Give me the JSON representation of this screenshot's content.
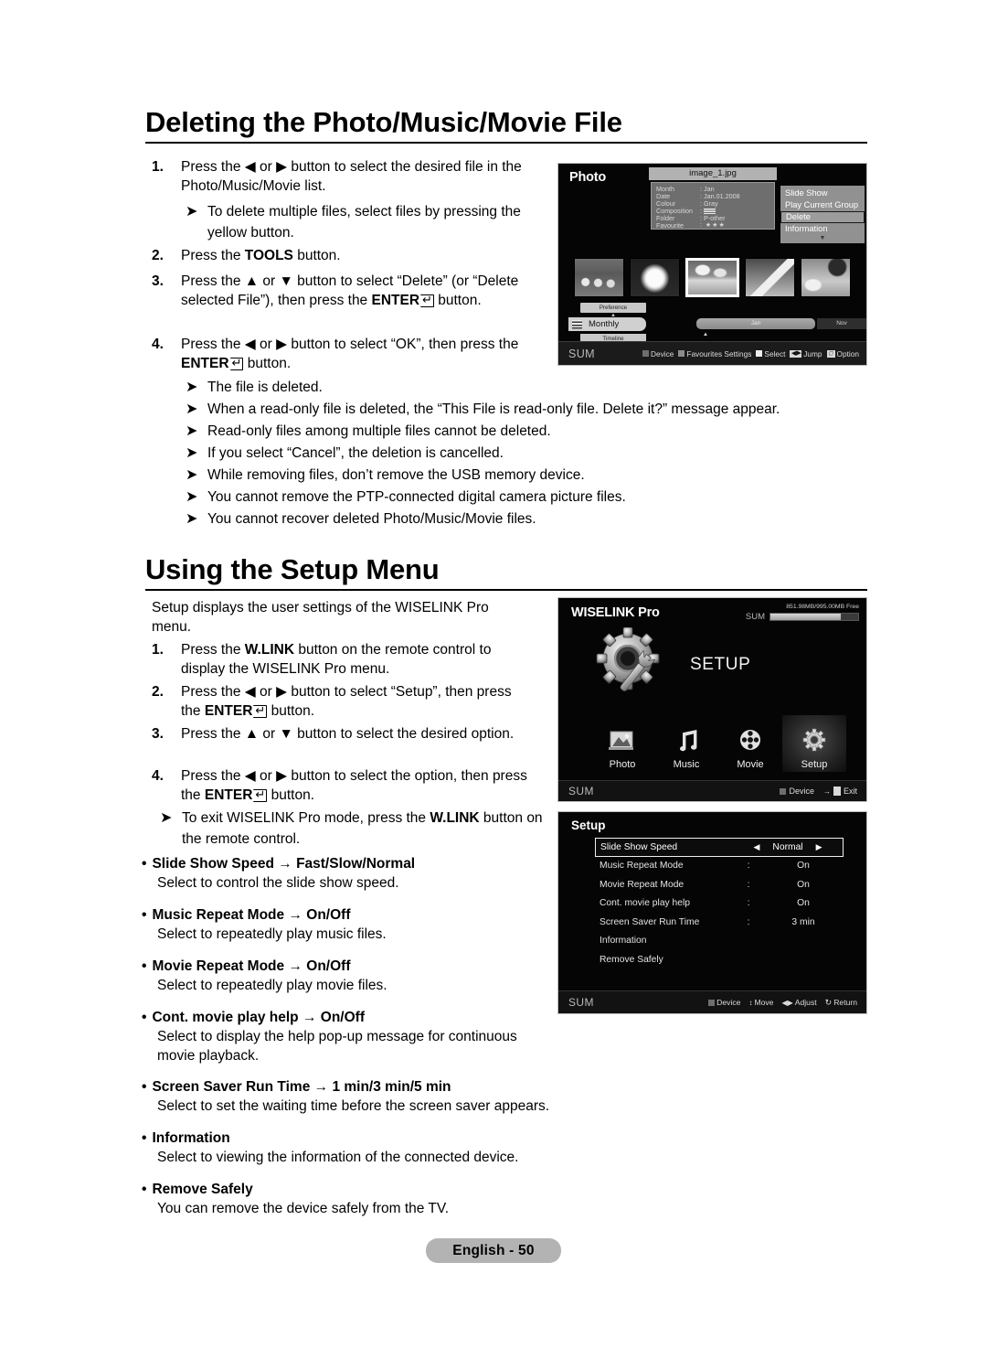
{
  "sections": [
    {
      "heading": "Deleting the Photo/Music/Movie File",
      "steps": [
        {
          "n": "1.",
          "text": "Press the ◀ or ▶ button to select the desired file in the Photo/Music/Movie list."
        },
        {
          "n": "2.",
          "text": "Press the TOOLS button."
        },
        {
          "n": "3.",
          "text": "Press the ▲ or ▼ button to select “Delete” (or “Delete selected File”), then press the ENTER button."
        },
        {
          "n": "4.",
          "text": "Press the ◀ or ▶ button to select “OK”, then press the ENTER button."
        }
      ],
      "note_inline": "To delete multiple files, select files by pressing the yellow button.",
      "notes": [
        "The file is deleted.",
        "When a read-only file is deleted, the “This File is read-only file. Delete it?” message appear.",
        "Read-only files among multiple files cannot be deleted.",
        "If you select “Cancel”, the deletion is cancelled.",
        "While removing files, don’t remove the USB memory device.",
        "You cannot remove the PTP-connected digital camera picture files.",
        "You cannot recover deleted Photo/Music/Movie files."
      ]
    },
    {
      "heading": "Using the Setup Menu",
      "intro": "Setup displays the user settings of the WISELINK Pro menu.",
      "steps": [
        {
          "n": "1.",
          "text": "Press the W.LINK button on the remote control to display the WISELINK Pro menu."
        },
        {
          "n": "2.",
          "text": "Press the ◀ or ▶ button to select “Setup”, then press the ENTER button."
        },
        {
          "n": "3.",
          "text": "Press the ▲ or ▼ button to select the desired option."
        },
        {
          "n": "4.",
          "text": "Press the ◀ or ▶ button to select the option, then press the ENTER button."
        }
      ],
      "note_exit": "To exit WISELINK Pro mode, press the W.LINK button on the remote control."
    }
  ],
  "definitions": [
    {
      "term": "Slide Show Speed",
      "arrow": "→",
      "options": "Fast/Slow/Normal",
      "desc": "Select to control the slide show speed."
    },
    {
      "term": "Music Repeat Mode",
      "arrow": "→",
      "options": "On/Off",
      "desc": "Select to repeatedly play music files."
    },
    {
      "term": "Movie Repeat Mode",
      "arrow": "→",
      "options": "On/Off",
      "desc": "Select to repeatedly play movie files."
    },
    {
      "term": "Cont. movie play help",
      "arrow": "→",
      "options": "On/Off",
      "desc": "Select to display the help pop-up message for continuous movie playback."
    },
    {
      "term": "Screen Saver Run Time",
      "arrow": "→",
      "options": "1 min/3 min/5 min",
      "desc": "Select to set the waiting time before the screen saver appears."
    },
    {
      "term": "Information",
      "arrow": "",
      "options": "",
      "desc": "Select to viewing the information of the connected device."
    },
    {
      "term": "Remove Safely",
      "arrow": "",
      "options": "",
      "desc": "You can remove the device safely from the TV."
    }
  ],
  "page_number": "English - 50",
  "photo_screen": {
    "title": "Photo",
    "filename": "image_1.jpg",
    "info": [
      {
        "key": "Month",
        "value": ": Jan"
      },
      {
        "key": "Date",
        "value": ": Jan.01.2008"
      },
      {
        "key": "Colour",
        "value": ": Gray"
      },
      {
        "key": "Composition",
        "value": ":"
      },
      {
        "key": "Folder",
        "value": ": P-other"
      },
      {
        "key": "Favourite",
        "value": ": ★★★"
      }
    ],
    "menu": [
      {
        "label": "Slide Show",
        "selected": false
      },
      {
        "label": "Play Current Group",
        "selected": false
      },
      {
        "label": "Delete",
        "selected": true
      },
      {
        "label": "Information",
        "selected": false
      }
    ],
    "menu_more": "▼",
    "thumbnails": [
      "sheep",
      "flower",
      "sky",
      "mountain",
      "palm"
    ],
    "selected_thumbnail_index": 2,
    "preference_label": "Preference",
    "monthly_label": "Monthly",
    "timeline_label": "Timeline",
    "bar_current": "Jan",
    "bar_end": "Nov",
    "footer": {
      "sum": "SUM",
      "keys": [
        {
          "icon": "red-square",
          "label": "Device"
        },
        {
          "icon": "green-square",
          "label": "Favourites Settings"
        },
        {
          "icon": "yellow-square",
          "label": "Select"
        },
        {
          "icon": "jump-arrows",
          "label": "Jump"
        },
        {
          "icon": "tools-option",
          "label": "Option"
        }
      ]
    }
  },
  "wiselink_screen": {
    "title": "WISELINK Pro",
    "memory_text": "851.98MB/995.00MB Free",
    "memory_sum": "SUM",
    "hero_label": "SETUP",
    "icons": [
      {
        "label": "Photo",
        "icon": "photo-icon",
        "active": false
      },
      {
        "label": "Music",
        "icon": "music-note-icon",
        "active": false
      },
      {
        "label": "Movie",
        "icon": "film-reel-icon",
        "active": false
      },
      {
        "label": "Setup",
        "icon": "gear-icon",
        "active": true
      }
    ],
    "footer": {
      "sum": "SUM",
      "keys": [
        {
          "icon": "red-square",
          "label": "Device"
        },
        {
          "icon": "exit-door",
          "label": "Exit"
        }
      ]
    }
  },
  "setup_screen": {
    "title": "Setup",
    "rows": [
      {
        "label": "Slide Show Speed",
        "sep": "",
        "value": "Normal",
        "selected": true,
        "adjustable": true
      },
      {
        "label": "Music Repeat Mode",
        "sep": ":",
        "value": "On",
        "selected": false,
        "adjustable": false
      },
      {
        "label": "Movie Repeat Mode",
        "sep": ":",
        "value": "On",
        "selected": false,
        "adjustable": false
      },
      {
        "label": "Cont. movie play help",
        "sep": ":",
        "value": "On",
        "selected": false,
        "adjustable": false
      },
      {
        "label": "Screen Saver Run Time",
        "sep": ":",
        "value": "3 min",
        "selected": false,
        "adjustable": false
      },
      {
        "label": "Information",
        "sep": "",
        "value": "",
        "selected": false,
        "adjustable": false
      },
      {
        "label": "Remove Safely",
        "sep": "",
        "value": "",
        "selected": false,
        "adjustable": false
      }
    ],
    "footer": {
      "sum": "SUM",
      "keys": [
        {
          "icon": "red-square",
          "label": "Device"
        },
        {
          "icon": "updown-arrows",
          "label": "Move"
        },
        {
          "icon": "leftright-arrows",
          "label": "Adjust"
        },
        {
          "icon": "return-arrow",
          "label": "Return"
        }
      ]
    }
  }
}
